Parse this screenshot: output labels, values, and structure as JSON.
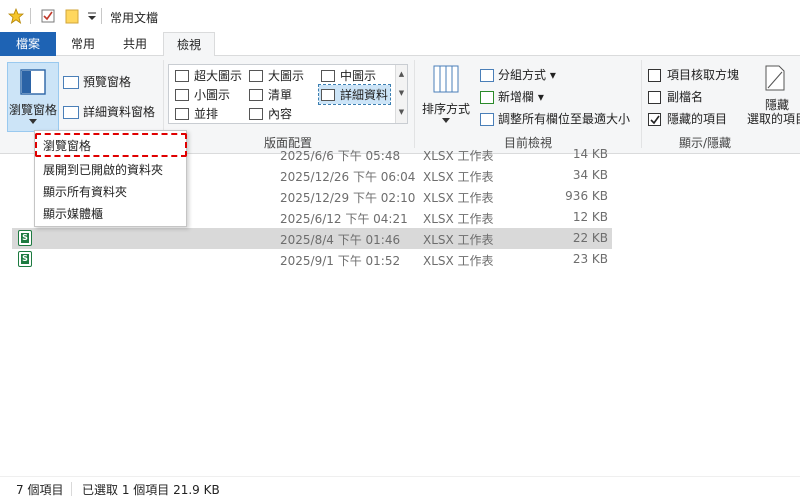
{
  "title": {
    "window_title": "常用文檔"
  },
  "tabs": [
    {
      "label": "檔案"
    },
    {
      "label": "常用"
    },
    {
      "label": "共用"
    },
    {
      "label": "檢視"
    }
  ],
  "ribbon": {
    "pane": {
      "navigation_pane_label": "瀏覽窗格",
      "preview_pane_label": "預覽窗格",
      "details_pane_label": "詳細資料窗格"
    },
    "layout": {
      "group_label": "版面配置",
      "items": [
        {
          "label": "超大圖示"
        },
        {
          "label": "大圖示"
        },
        {
          "label": "中圖示"
        },
        {
          "label": "小圖示"
        },
        {
          "label": "清單"
        },
        {
          "label": "詳細資料"
        },
        {
          "label": "並排"
        },
        {
          "label": "內容"
        }
      ]
    },
    "current_view": {
      "group_label": "目前檢視",
      "sort_label": "排序方式",
      "group_by_label": "分組方式",
      "add_column_label": "新增欄",
      "size_columns_label": "調整所有欄位至最適大小"
    },
    "show_hide": {
      "group_label": "顯示/隱藏",
      "item_checkboxes_label": "項目核取方塊",
      "extensions_label": "副檔名",
      "hidden_items_label": "隱藏的項目",
      "hide_selected_line1": "隱藏",
      "hide_selected_line2": "選取的項目"
    }
  },
  "dropdown": {
    "items": [
      {
        "label": "瀏覽窗格"
      },
      {
        "label": "展開到已開啟的資料夾"
      },
      {
        "label": "顯示所有資料夾"
      },
      {
        "label": "顯示媒體櫃"
      }
    ]
  },
  "files": [
    {
      "date": "2025/6/6 下午 05:48",
      "type": "XLSX 工作表",
      "size": "14 KB"
    },
    {
      "date": "2025/12/26 下午 06:04",
      "type": "XLSX 工作表",
      "size": "34 KB"
    },
    {
      "date": "2025/12/29 下午 02:10",
      "type": "XLSX 工作表",
      "size": "936 KB"
    },
    {
      "date": "2025/6/12 下午 04:21",
      "type": "XLSX 工作表",
      "size": "12 KB"
    },
    {
      "date": "2025/8/4 下午 01:46",
      "type": "XLSX 工作表",
      "size": "22 KB"
    },
    {
      "date": "2025/9/1 下午 01:52",
      "type": "XLSX 工作表",
      "size": "23 KB"
    }
  ],
  "status": {
    "item_count": "7 個項目",
    "selected_info": "已選取 1 個項目  21.9 KB"
  }
}
